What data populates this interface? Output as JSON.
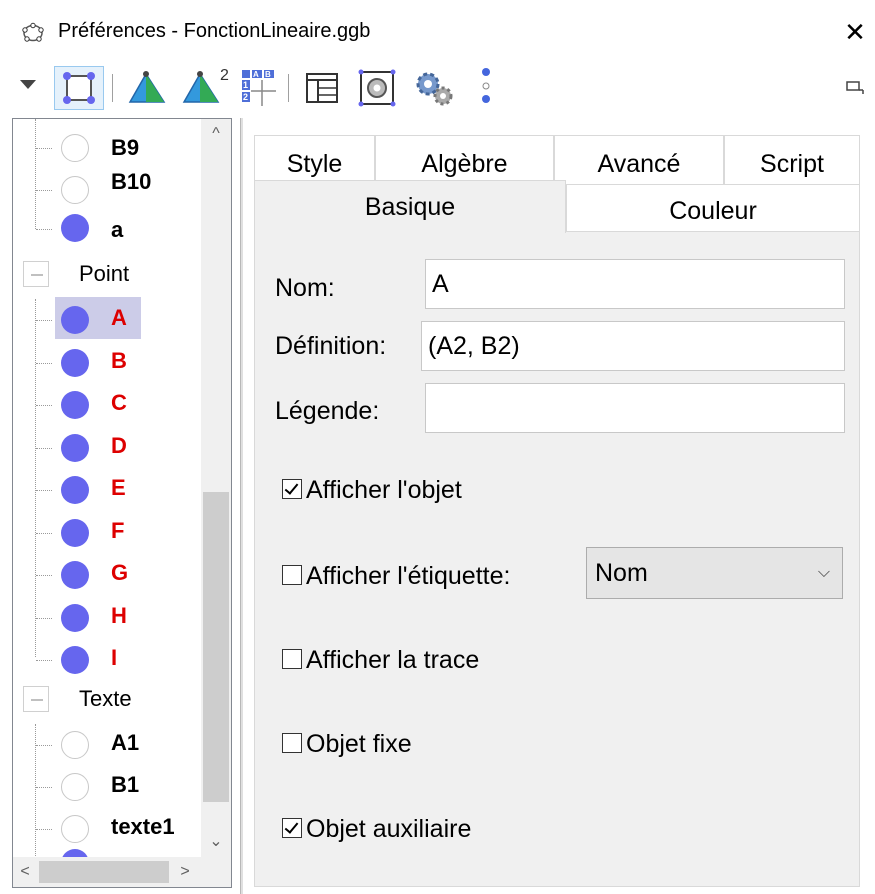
{
  "window": {
    "title": "Préférences - FonctionLineaire.ggb",
    "close": "✕"
  },
  "toolbar": {
    "icons": [
      "dropdown-arrow-icon",
      "graphics-objects-icon",
      "3d-objects-icon",
      "3d-2-objects-icon",
      "spreadsheet-objects-icon",
      "layout-icon",
      "graphics-settings-icon",
      "advanced-gear-icon",
      "more-vertical-icon",
      "restore-window-icon"
    ],
    "spreadsheet_glyph": {
      "a": "A",
      "b": "B",
      "one": "1",
      "two": "2"
    },
    "exponent": "2"
  },
  "tree": {
    "items_top": [
      {
        "label": "B9",
        "fill": "empty"
      },
      {
        "label": "B10",
        "fill": "empty"
      },
      {
        "label": "a",
        "fill": "full"
      }
    ],
    "group_point": "Point",
    "points": [
      "A",
      "B",
      "C",
      "D",
      "E",
      "F",
      "G",
      "H",
      "I"
    ],
    "selected": "A",
    "group_text": "Texte",
    "texts": [
      {
        "label": "A1",
        "fill": "empty"
      },
      {
        "label": "B1",
        "fill": "empty"
      },
      {
        "label": "texte1",
        "fill": "empty"
      }
    ],
    "scroll_up": "^",
    "scroll_down": "⌄",
    "scroll_left": "<",
    "scroll_right": ">"
  },
  "tabs": {
    "row_back": [
      "Style",
      "Algèbre",
      "Avancé",
      "Script"
    ],
    "row_front": [
      "Basique",
      "Couleur"
    ],
    "active": "Basique"
  },
  "basic": {
    "name_label": "Nom:",
    "name_value": "A",
    "definition_label": "Définition:",
    "definition_value": "(A2, B2)",
    "caption_label": "Légende:",
    "caption_value": "",
    "show_object": {
      "label": "Afficher l'objet",
      "checked": true
    },
    "show_label": {
      "label": "Afficher l'étiquette:",
      "checked": false
    },
    "label_mode": "Nom",
    "show_trace": {
      "label": "Afficher la trace",
      "checked": false
    },
    "fix_object": {
      "label": "Objet fixe",
      "checked": false
    },
    "auxiliary": {
      "label": "Objet auxiliaire",
      "checked": true
    }
  },
  "colors": {
    "point_fill": "#6666ee",
    "point_label": "#dd0000",
    "selection": "#cccce8",
    "tab_border": "#d9d9d9",
    "panel_bg": "#f0f0f0"
  }
}
